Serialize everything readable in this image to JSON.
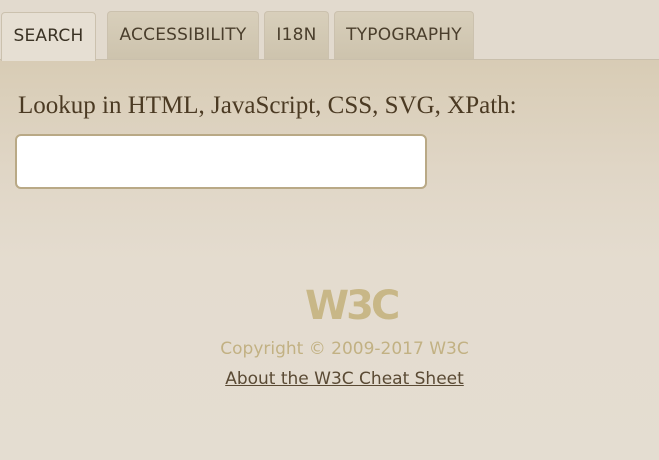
{
  "tabs": [
    {
      "label": "SEARCH",
      "active": true
    },
    {
      "label": "ACCESSIBILITY",
      "active": false
    },
    {
      "label": "I18N",
      "active": false
    },
    {
      "label": "TYPOGRAPHY",
      "active": false
    }
  ],
  "search": {
    "label": "Lookup in HTML, JavaScript, CSS, SVG, XPath:",
    "value": "",
    "placeholder": ""
  },
  "footer": {
    "logo_text": "W3C",
    "copyright": "Copyright © 2009-2017 W3C",
    "about_link": "About the W3C Cheat Sheet"
  },
  "colors": {
    "background": "#e4dccc",
    "text_brown": "#4b3a23",
    "accent_tan": "#c2b183"
  }
}
